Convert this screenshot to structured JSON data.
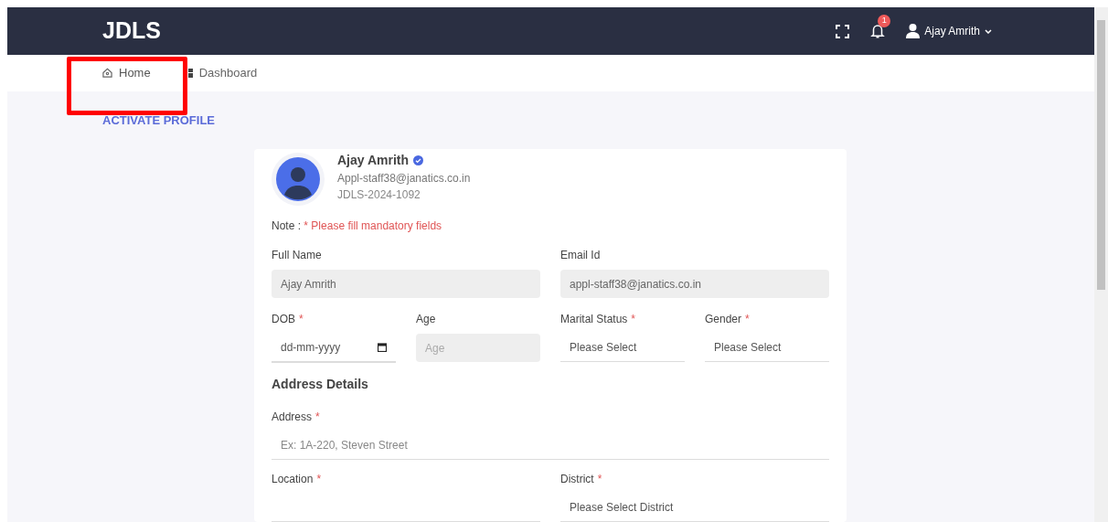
{
  "header": {
    "logo": "JDLS",
    "notification_count": "1",
    "user_name": "Ajay Amrith"
  },
  "nav": [
    {
      "label": "Home",
      "selected": true
    },
    {
      "label": "Dashboard",
      "selected": false
    }
  ],
  "page_title": "ACTIVATE PROFILE",
  "profile": {
    "name": "Ajay Amrith",
    "verified": true,
    "email": "Appl-staff38@janatics.co.in",
    "id": "JDLS-2024-1092"
  },
  "note": {
    "label": "Note :",
    "text": "* Please fill mandatory fields"
  },
  "rows": [
    [
      {
        "label": "Full Name",
        "kind": "text",
        "value": "Ajay Amrith",
        "disabled": true
      },
      {
        "label": "Email Id",
        "kind": "text",
        "value": "appl-staff38@janatics.co.in",
        "disabled": true
      }
    ],
    [
      {
        "label": "DOB",
        "required_mark": "*",
        "kind": "date",
        "placeholder": "dd-mm-yyyy",
        "disabled": false
      },
      {
        "label": "Age",
        "kind": "text",
        "placeholder": "Age",
        "disabled": true
      },
      {
        "label": "Marital Status",
        "required_mark": "*",
        "kind": "select",
        "placeholder": "Please Select",
        "disabled": false
      },
      {
        "label": "Gender",
        "required_mark": "*",
        "kind": "select",
        "placeholder": "Please Select",
        "disabled": false
      }
    ]
  ],
  "section": "Address Details",
  "address_rows": [
    [
      {
        "label": "Address",
        "required_mark": "*",
        "kind": "text",
        "placeholder": "Ex: 1A-220, Steven Street",
        "disabled": false
      }
    ],
    [
      {
        "label": "Location",
        "required_mark": "*",
        "kind": "text",
        "disabled": false
      },
      {
        "label": "District",
        "required_mark": "*",
        "kind": "select",
        "placeholder": "Please Select District",
        "disabled": false
      }
    ]
  ]
}
